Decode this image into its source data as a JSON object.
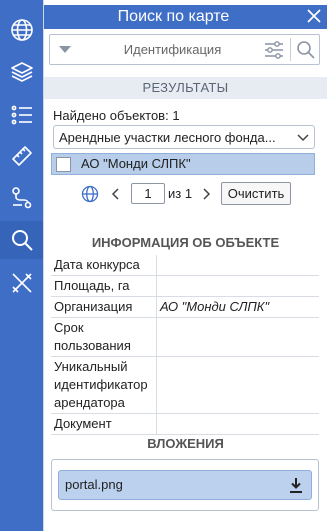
{
  "rail": {
    "items": [
      {
        "icon": "globe-icon"
      },
      {
        "icon": "layers-icon"
      },
      {
        "icon": "list-icon"
      },
      {
        "icon": "ruler-icon"
      },
      {
        "icon": "route-icon"
      },
      {
        "icon": "search-icon",
        "active": true
      },
      {
        "icon": "tools-icon"
      }
    ]
  },
  "panel": {
    "title": "Поиск по карте",
    "search_mode": "Идентификация",
    "results_header": "РЕЗУЛЬТАТЫ",
    "found_text": "Найдено объектов: 1",
    "layer_select": "Арендные участки лесного фонда...",
    "result_item": "АО \"Монди СЛПК\"",
    "pager": {
      "page": "1",
      "of_text": "из 1",
      "clear_label": "Очистить"
    },
    "info_title": "ИНФОРМАЦИЯ ОБ ОБЪЕКТЕ",
    "attributes": [
      {
        "key": "Дата конкурса",
        "value": ""
      },
      {
        "key": "Площадь, га",
        "value": ""
      },
      {
        "key": "Организация",
        "value": "АО \"Монди СЛПК\""
      },
      {
        "key": "Срок пользования",
        "value": ""
      },
      {
        "key": "Уникальный идентификатор арендатора",
        "value": ""
      },
      {
        "key": "Документ",
        "value": ""
      }
    ],
    "attachments_title": "ВЛОЖЕНИЯ",
    "attachment_file": "portal.png"
  },
  "colors": {
    "accent": "#3f6ec7",
    "selection": "#b7cde9",
    "header_bg": "#e7ecf3"
  }
}
